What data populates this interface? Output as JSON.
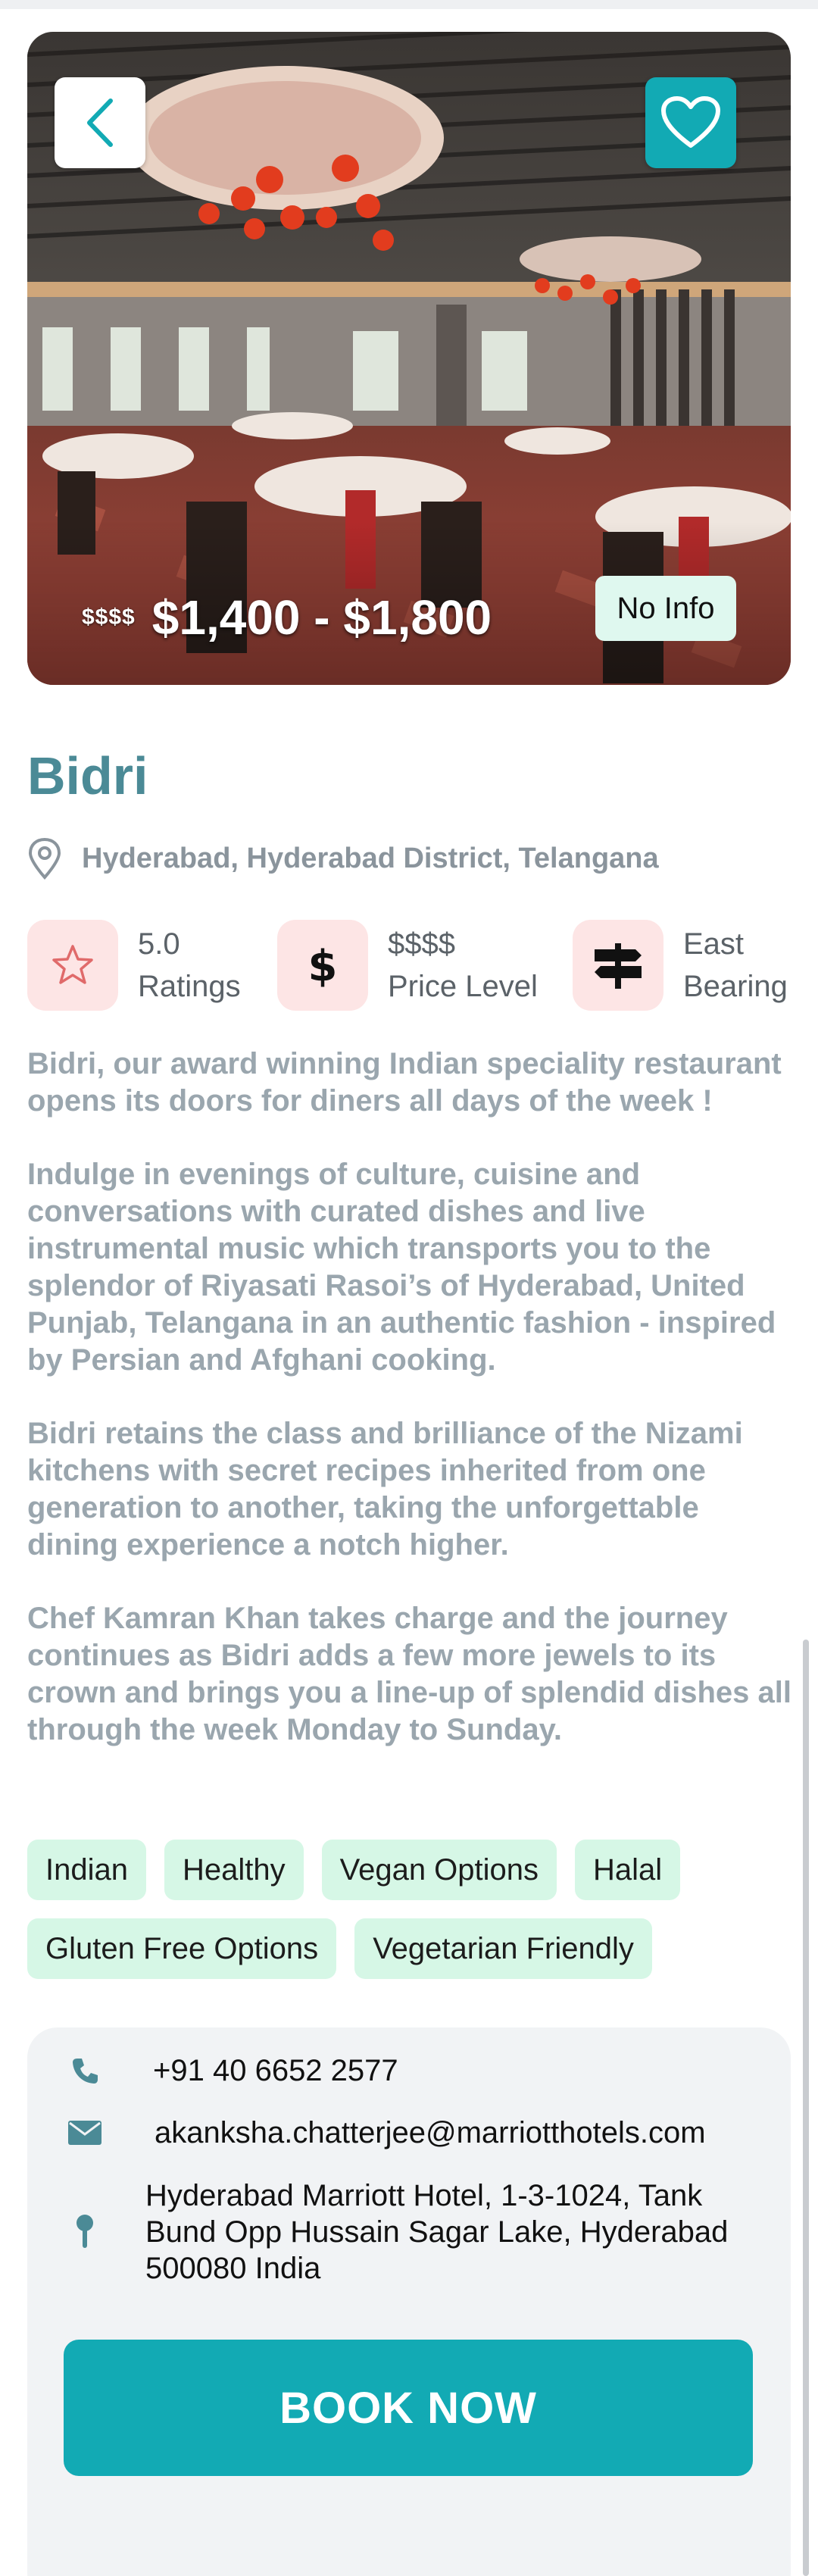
{
  "hero": {
    "price_level": "$$$$",
    "price_range": "$1,400 - $1,800",
    "status_badge": "No Info"
  },
  "restaurant": {
    "name": "Bidri",
    "location": "Hyderabad, Hyderabad District, Telangana"
  },
  "stats": {
    "rating_value": "5.0",
    "rating_label": "Ratings",
    "price_value": "$$$$",
    "price_label": "Price Level",
    "bearing_value": "East",
    "bearing_label": "Bearing"
  },
  "description": [
    "Bidri, our award winning Indian speciality restaurant opens its doors for diners all days of the week !",
    "Indulge in evenings of culture, cuisine and conversations with curated dishes and live instrumental music which transports you to the splendor of Riyasati Rasoi’s of Hyderabad, United Punjab, Telangana in an authentic fashion - inspired by Persian and Afghani cooking.",
    "Bidri retains the class and brilliance of the Nizami kitchens with secret recipes inherited from one generation to another, taking the unforgettable dining experience a notch higher.",
    "Chef Kamran Khan takes charge and the journey continues as Bidri adds a few more jewels to its crown and brings you a line-up of splendid dishes all through the week Monday to Sunday."
  ],
  "tags": [
    "Indian",
    "Healthy",
    "Vegan Options",
    "Halal",
    "Gluten Free Options",
    "Vegetarian Friendly"
  ],
  "contact": {
    "phone": "+91 40 6652 2577",
    "email": "akanksha.chatterjee@marriotthotels.com",
    "address": "Hyderabad Marriott Hotel, 1-3-1024, Tank Bund Opp Hussain Sagar Lake, Hyderabad 500080 India"
  },
  "actions": {
    "book_label": "BOOK NOW"
  },
  "colors": {
    "accent": "#12aab4",
    "title": "#4b8a96",
    "tag_bg": "#d6f7e6",
    "stat_icon_bg": "#fde5e5",
    "card_bg": "#f1f3f5"
  },
  "icons": [
    "back-chevron-icon",
    "heart-icon",
    "location-pin-icon",
    "star-icon",
    "dollar-icon",
    "signpost-icon",
    "phone-icon",
    "mail-icon",
    "map-marker-icon"
  ]
}
